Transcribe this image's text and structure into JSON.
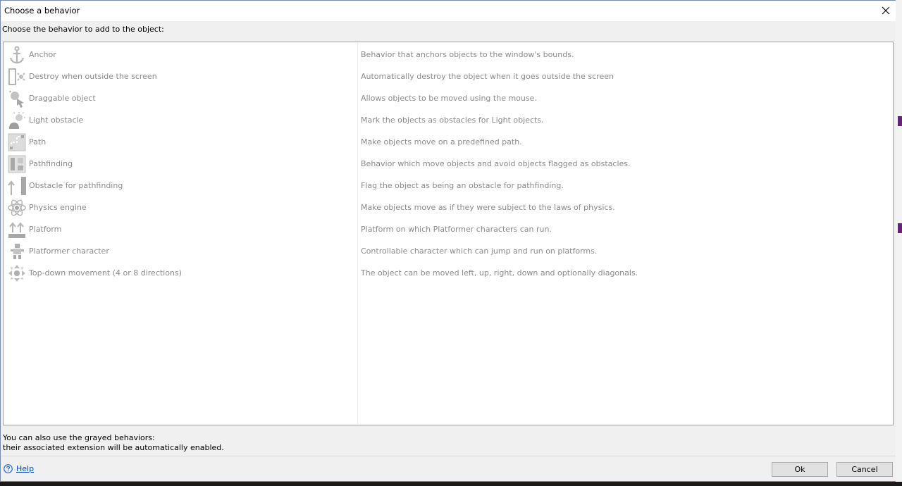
{
  "window": {
    "title": "Choose a behavior",
    "close_icon": "close-icon"
  },
  "prompt": "Choose the behavior to add to the object:",
  "behaviors": [
    {
      "name": "Anchor",
      "description": "Behavior that anchors objects to the window's bounds.",
      "icon": "anchor-icon"
    },
    {
      "name": "Destroy when outside the screen",
      "description": "Automatically destroy the object when it goes outside the screen",
      "icon": "destroy-outside-icon"
    },
    {
      "name": "Draggable object",
      "description": "Allows objects to be moved using the mouse.",
      "icon": "draggable-icon"
    },
    {
      "name": "Light obstacle",
      "description": "Mark the objects as obstacles for Light objects.",
      "icon": "light-obstacle-icon"
    },
    {
      "name": "Path",
      "description": "Make objects move on a predefined path.",
      "icon": "path-icon"
    },
    {
      "name": "Pathfinding",
      "description": "Behavior which move objects and avoid objects flagged as obstacles.",
      "icon": "pathfinding-icon"
    },
    {
      "name": "Obstacle for pathfinding",
      "description": "Flag the object as being an obstacle for pathfinding.",
      "icon": "pathfinding-obstacle-icon"
    },
    {
      "name": "Physics engine",
      "description": "Make objects move as if they were subject to the laws of physics.",
      "icon": "physics-icon"
    },
    {
      "name": "Platform",
      "description": "Platform on which Platformer characters can run.",
      "icon": "platform-icon"
    },
    {
      "name": "Platformer character",
      "description": "Controllable character which can jump and run on platforms.",
      "icon": "platformer-character-icon"
    },
    {
      "name": "Top-down movement (4 or 8 directions)",
      "description": "The object can be moved left, up, right, down and optionally diagonals.",
      "icon": "top-down-movement-icon"
    }
  ],
  "hint": {
    "line1": "You can also use the grayed behaviors:",
    "line2": "their associated extension will be automatically enabled."
  },
  "footer": {
    "help_label": "Help",
    "ok_label": "Ok",
    "cancel_label": "Cancel"
  },
  "colors": {
    "grayed_text": "#8a8a8a",
    "link": "#0645ad",
    "window_border": "#6e8fb5",
    "accent_strip": "#68217a"
  }
}
